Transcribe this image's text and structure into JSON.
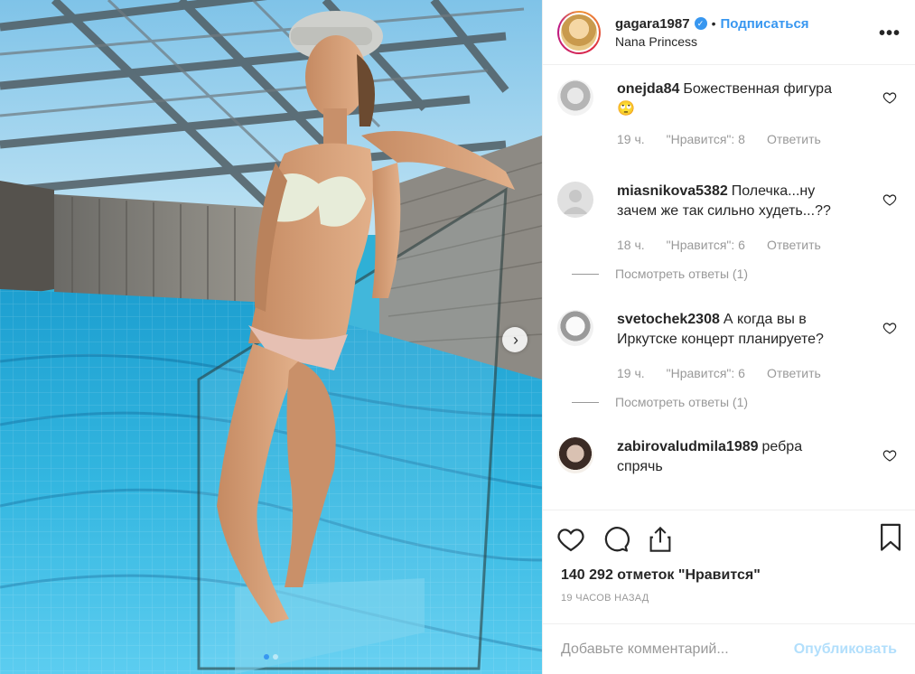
{
  "post": {
    "author": {
      "username": "gagara1987",
      "verified_icon": "verified-badge-icon",
      "separator": "•",
      "follow_label": "Подписаться",
      "location": "Nana Princess"
    },
    "more_icon": "more-options-icon",
    "more_label": "•••",
    "image": {
      "description_icon": "photo",
      "next_icon": "chevron-right-icon",
      "next_label": "›",
      "carousel_dots": 2,
      "carousel_active": 0
    },
    "comments": [
      {
        "username": "onejda84",
        "text": "Божественная фигура 🙄",
        "time": "19 ч.",
        "likes": "\"Нравится\": 8",
        "reply": "Ответить",
        "view_replies": null
      },
      {
        "username": "miasnikova5382",
        "text": "Полечка...ну зачем же так сильно худеть...??",
        "time": "18 ч.",
        "likes": "\"Нравится\": 6",
        "reply": "Ответить",
        "view_replies": "Посмотреть ответы (1)"
      },
      {
        "username": "svetochek2308",
        "text": "А когда вы в Иркутске концерт планируете?",
        "time": "19 ч.",
        "likes": "\"Нравится\": 6",
        "reply": "Ответить",
        "view_replies": "Посмотреть ответы (1)"
      },
      {
        "username": "zabirovaludmila1989",
        "text": "ребра спрячь",
        "time": "",
        "likes": "",
        "reply": "",
        "view_replies": null
      }
    ],
    "actions": {
      "like_icon": "heart-icon",
      "comment_icon": "comment-icon",
      "share_icon": "share-icon",
      "save_icon": "bookmark-icon"
    },
    "likes_total": "140 292 отметок \"Нравится\"",
    "time_ago": "19 часов назад",
    "add_comment": {
      "placeholder": "Добавьте комментарий...",
      "publish_label": "Опубликовать"
    },
    "colors": {
      "accent": "#3897f0",
      "publish_disabled": "#b2dffc",
      "muted": "#999999",
      "text": "#262626"
    }
  }
}
